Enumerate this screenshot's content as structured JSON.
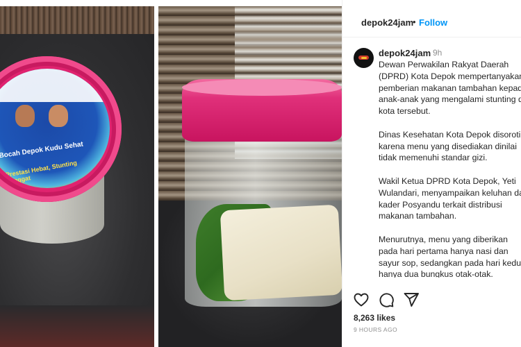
{
  "header": {
    "username": "depok24jam",
    "separator": "•",
    "follow_label": "Follow"
  },
  "post": {
    "username": "depok24jam",
    "time": "9h",
    "caption": "Dewan Perwakilan Rakyat Daerah\n(DPRD) Kota Depok mempertanyakan\npemberian makanan tambahan kepada\nanak-anak yang mengalami stunting di\nkota tersebut.\n\nDinas Kesehatan Kota Depok disoroti\nkarena menu yang disediakan dinilai\ntidak memenuhi standar gizi.\n\nWakil Ketua DPRD Kota Depok, Yeti\nWulandari, menyampaikan keluhan dari\nkader Posyandu terkait distribusi\nmakanan tambahan.\n\nMenurutnya, menu yang diberikan\npada hari pertama hanya nasi dan\nsayur sop, sedangkan pada hari kedua\nhanya dua bungkus otak-otak.",
    "likes": "8,263 likes",
    "time_ago": "9 HOURS AGO"
  },
  "photos": {
    "left_label_line1": "Bocah Depok Kudu Sehat",
    "left_label_line2": "Prestasi Hebat, Stunting Minggat"
  },
  "icons": {
    "like": "heart-icon",
    "comment": "comment-icon",
    "share": "share-icon"
  },
  "colors": {
    "follow": "#0095f6",
    "text": "#262626",
    "muted": "#8e8e8e",
    "lid_pink": "#e0236f"
  }
}
